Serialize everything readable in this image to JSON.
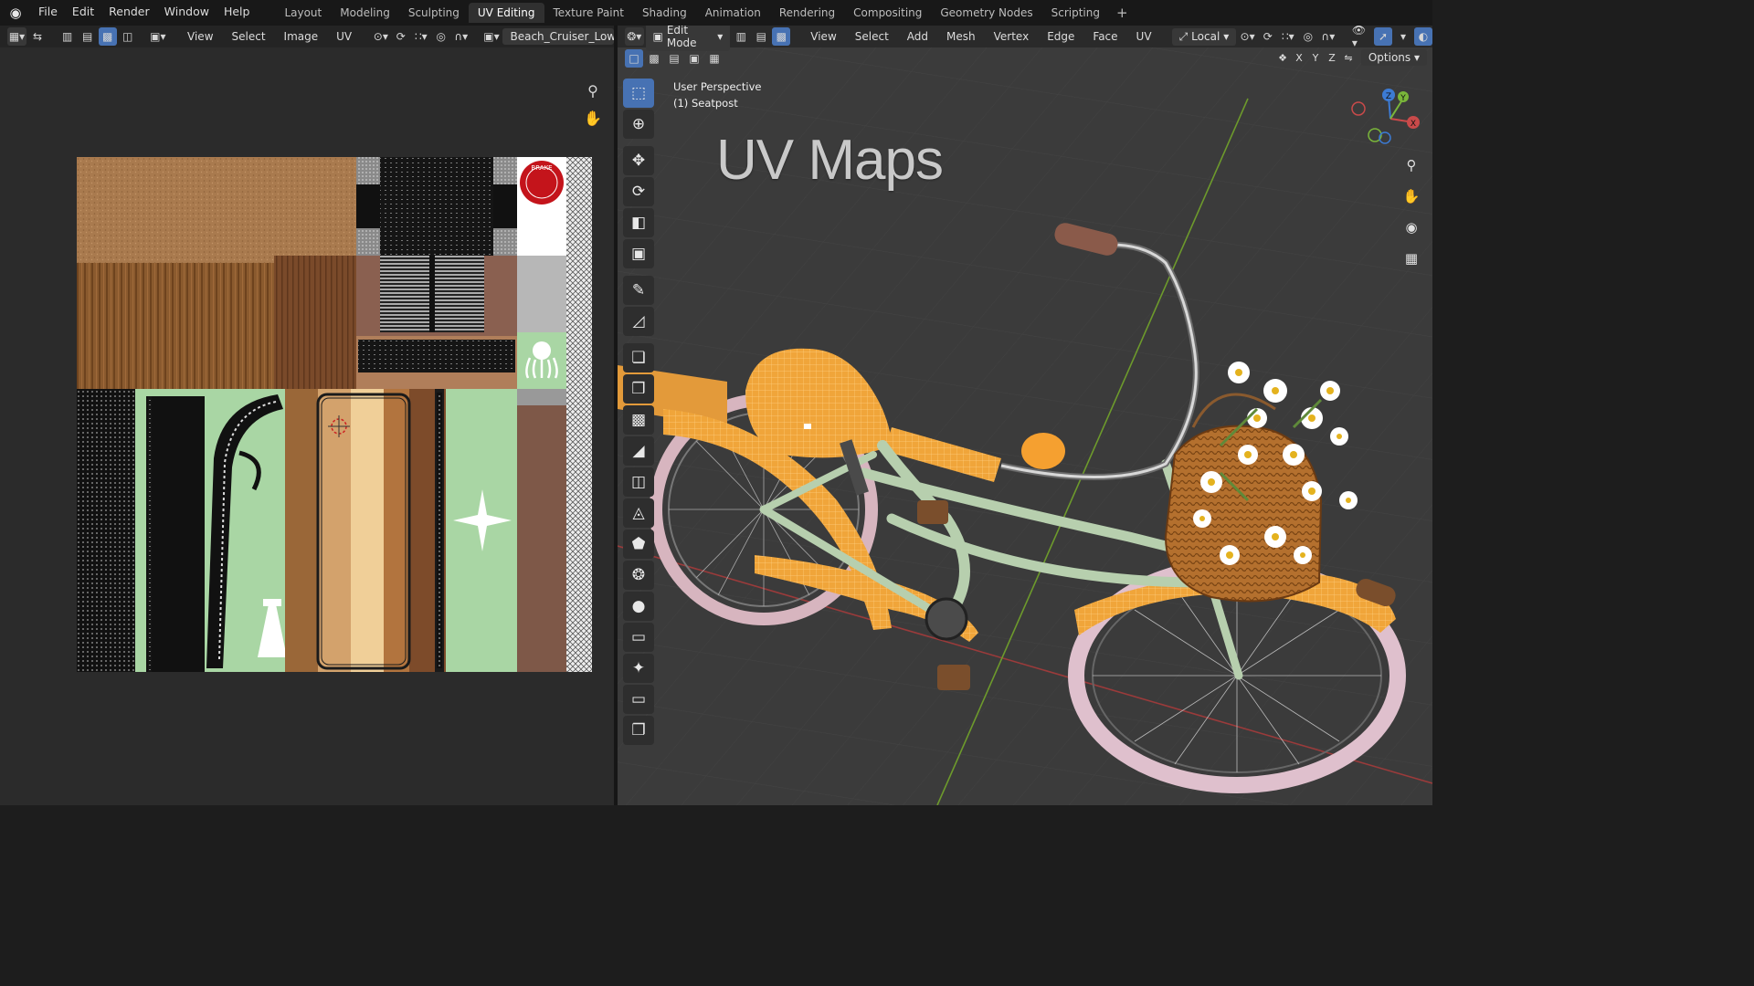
{
  "topbar": {
    "menus": [
      "File",
      "Edit",
      "Render",
      "Window",
      "Help"
    ],
    "workspaces": [
      "Layout",
      "Modeling",
      "Sculpting",
      "UV Editing",
      "Texture Paint",
      "Shading",
      "Animation",
      "Rendering",
      "Compositing",
      "Geometry Nodes",
      "Scripting"
    ],
    "active_workspace": "UV Editing"
  },
  "uv_editor": {
    "menus": [
      "View",
      "Select",
      "Image",
      "UV"
    ],
    "image_name": "Beach_Cruiser_LowPc",
    "badge_text": "BRAKE"
  },
  "viewport": {
    "mode": "Edit Mode",
    "menus": [
      "View",
      "Select",
      "Add",
      "Mesh",
      "Vertex",
      "Edge",
      "Face",
      "UV"
    ],
    "transform_orientation": "Local",
    "options_label": "Options",
    "axis_toggles": [
      "X",
      "Y",
      "Z"
    ],
    "perspective_label": "User Perspective",
    "object_label": "(1) Seatpost",
    "overlay_title": "UV Maps",
    "gizmo_axes": [
      "Z",
      "Y",
      "X"
    ]
  },
  "colors": {
    "accent": "#4772b3",
    "selection": "#f5a030",
    "bike_frame": "#b7cfae",
    "uv_green": "#a9d6a4"
  }
}
